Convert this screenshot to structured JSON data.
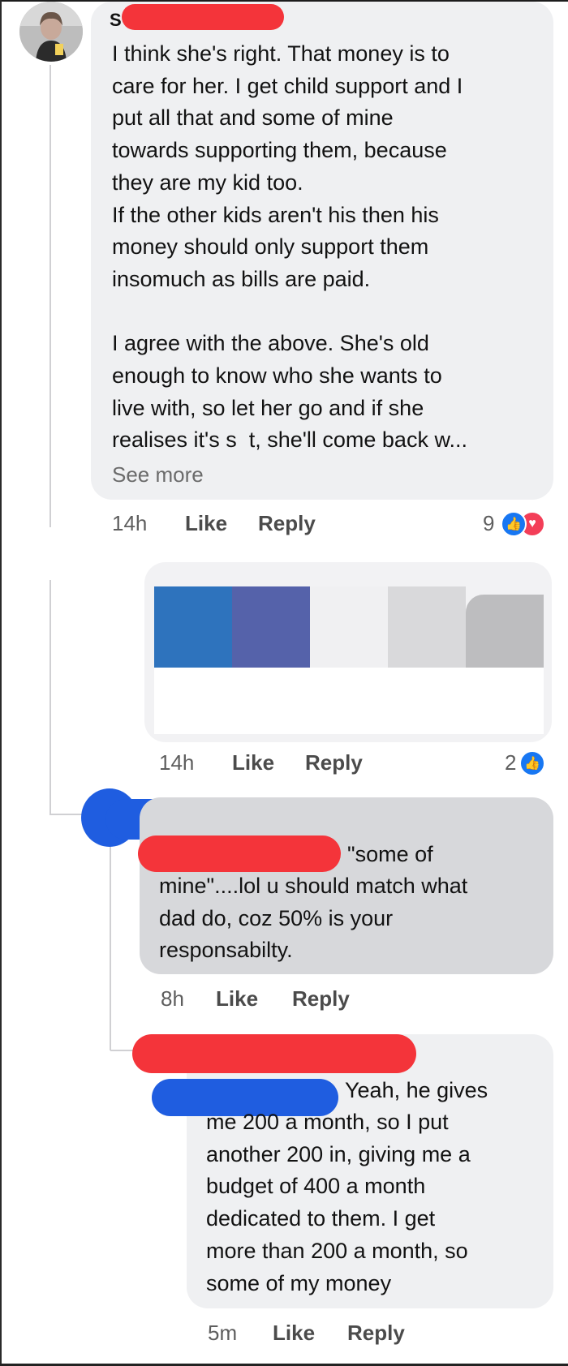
{
  "comment1": {
    "author_initial": "S",
    "text": "I think she's right. That money is to\ncare for her. I get child support and I\nput all that and some of mine\ntowards supporting them, because\nthey are my kid too.\nIf the other kids aren't his then his\nmoney should only support them\ninsomuch as bills are paid.\n\nI agree with the above. She's old\nenough to know who she wants to\nlive with, so let her go and if she\nrealises it's s  t, she'll come back w...",
    "see_more": "See more",
    "time": "14h",
    "like": "Like",
    "reply": "Reply",
    "reaction_count": "9"
  },
  "comment2": {
    "time": "14h",
    "like": "Like",
    "reply": "Reply",
    "reaction_count": "2",
    "swatch_colors": [
      "#2e73bd",
      "#5562aa",
      "#f0f0f2",
      "#d9d9db",
      "#bdbdbf"
    ]
  },
  "comment3": {
    "line1": "\"some of",
    "text": "mine\"....lol u should match what\ndad do, coz 50% is your\nresponsabilty.",
    "time": "8h",
    "like": "Like",
    "reply": "Reply"
  },
  "comment4": {
    "line1": "Yeah, he gives",
    "text": "me 200 a month, so I put\nanother 200 in, giving me a\nbudget of 400 a month\ndedicated to them. I get\nmore than 200 a month, so\nsome of my money",
    "time": "5m",
    "like": "Like",
    "reply": "Reply"
  },
  "icons": {
    "like": "thumbs-up-icon",
    "love": "heart-icon"
  },
  "colors": {
    "bubble": "#eff0f2",
    "bubble_dark": "#d7d8db",
    "like_blue": "#1877f2",
    "love_red": "#f33e58",
    "redaction_red": "#f4343a",
    "redaction_blue": "#1f5de0"
  }
}
